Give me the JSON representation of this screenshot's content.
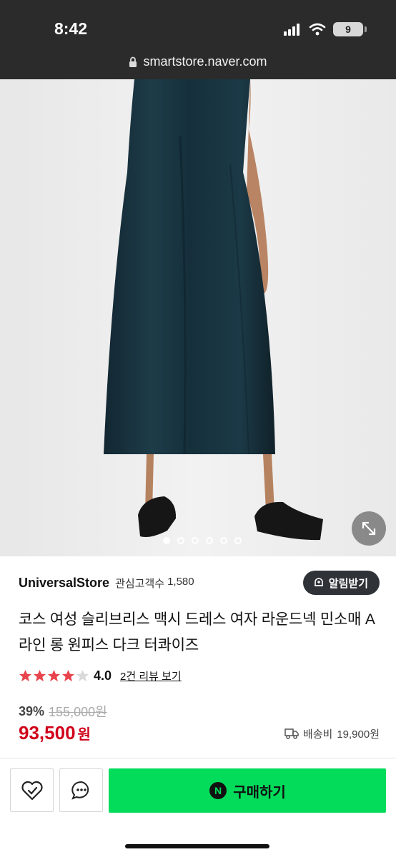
{
  "status": {
    "time": "8:42",
    "battery": "9"
  },
  "browser": {
    "url": "smartstore.naver.com"
  },
  "gallery": {
    "page_count": 6,
    "active_index": 0
  },
  "store": {
    "name": "UniversalStore",
    "fans_label": "관심고객수",
    "fans_count": "1,580",
    "alarm_label": "알림받기"
  },
  "product": {
    "title": "코스 여성 슬리브리스 맥시 드레스 여자 라운드넥 민소매 A라인 롱 원피스 다크 터콰이즈",
    "rating_value": 4.0,
    "rating": "4.0",
    "reviews_link": "2건 리뷰 보기",
    "discount": "39%",
    "original_price": "155,000원",
    "price": "93,500",
    "currency": "원",
    "shipping_label": "배송비",
    "shipping_fee": "19,900원"
  },
  "actions": {
    "buy_label": "구매하기",
    "buy_badge": "N",
    "wishlist_icon": "heart-icon",
    "chat_icon": "chat-icon"
  },
  "colors": {
    "star": "#e8444d",
    "price": "#d0021b",
    "buy": "#03dc5b",
    "topbar": "#2b2b2b"
  }
}
